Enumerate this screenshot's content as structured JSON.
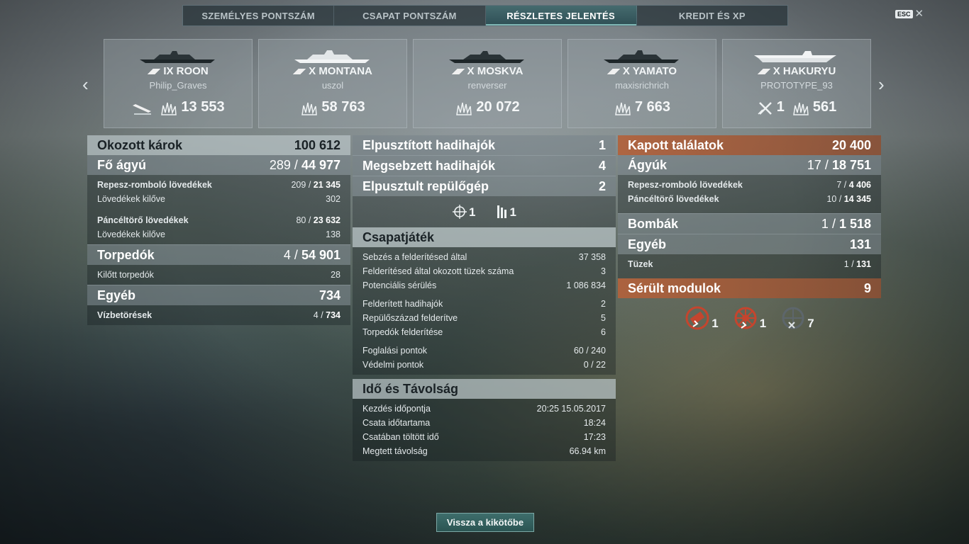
{
  "tabs": [
    "SZEMÉLYES PONTSZÁM",
    "CSAPAT PONTSZÁM",
    "RÉSZLETES JELENTÉS",
    "KREDIT ÉS XP"
  ],
  "esc_label": "ESC",
  "ships": [
    {
      "name": "IX ROON",
      "player": "Philip_Graves",
      "stat1_icon": "sunk-ship-icon",
      "stat1": "",
      "damage": "13 553"
    },
    {
      "name": "X MONTANA",
      "player": "uszol",
      "stat1_icon": "",
      "stat1": "",
      "damage": "58 763"
    },
    {
      "name": "X MOSKVA",
      "player": "renverser",
      "stat1_icon": "",
      "stat1": "",
      "damage": "20 072"
    },
    {
      "name": "X YAMATO",
      "player": "maxisrichrich",
      "stat1_icon": "",
      "stat1": "",
      "damage": "7 663"
    },
    {
      "name": "X HAKURYU",
      "player": "PROTOTYPE_93",
      "stat1_icon": "plane-shot-icon",
      "stat1": "1",
      "damage": "561"
    }
  ],
  "left": {
    "damage_label": "Okozott károk",
    "damage_value": "100 612",
    "main_label": "Fő ágyú",
    "main_hits": "289",
    "main_dmg": "44 977",
    "he_label": "Repesz-romboló lövedékek",
    "he_hits": "209",
    "he_dmg": "21 345",
    "he_fired_label": "Lövedékek kilőve",
    "he_fired": "302",
    "ap_label": "Páncéltörő lövedékek",
    "ap_hits": "80",
    "ap_dmg": "23 632",
    "ap_fired_label": "Lövedékek kilőve",
    "ap_fired": "138",
    "torp_label": "Torpedók",
    "torp_hits": "4",
    "torp_dmg": "54 901",
    "torp_fired_label": "Kilőtt torpedók",
    "torp_fired": "28",
    "other_label": "Egyéb",
    "other_value": "734",
    "flood_label": "Vízbetörések",
    "flood_hits": "4",
    "flood_dmg": "734"
  },
  "middle": {
    "destroyed_label": "Elpusztított hadihajók",
    "destroyed": "1",
    "damaged_label": "Megsebzett hadihajók",
    "damaged": "4",
    "planes_label": "Elpusztult repülőgép",
    "planes": "2",
    "icon_a": "1",
    "icon_b": "1",
    "team_label": "Csapatjáték",
    "team_rows": [
      {
        "label": "Sebzés a felderítésed által",
        "value": "37 358"
      },
      {
        "label": "Felderítésed által okozott tüzek száma",
        "value": "3"
      },
      {
        "label": "Potenciális sérülés",
        "value": "1 086 834"
      },
      {
        "label": "Felderített hadihajók",
        "value": "2"
      },
      {
        "label": "Repülőszázad felderítve",
        "value": "5"
      },
      {
        "label": "Torpedók felderítése",
        "value": "6"
      },
      {
        "label": "Foglalási pontok",
        "value": "60 / 240"
      },
      {
        "label": "Védelmi pontok",
        "value": "0 / 22"
      }
    ],
    "time_label": "Idő és Távolság",
    "time_rows": [
      {
        "label": "Kezdés időpontja",
        "value": "20:25  15.05.2017"
      },
      {
        "label": "Csata időtartama",
        "value": "18:24"
      },
      {
        "label": "Csatában töltött idő",
        "value": "17:23"
      },
      {
        "label": "Megtett távolság",
        "value": "66.94 km"
      }
    ]
  },
  "right": {
    "received_label": "Kapott találatok",
    "received_value": "20 400",
    "guns_label": "Ágyúk",
    "guns_hits": "17",
    "guns_dmg": "18 751",
    "he_label": "Repesz-romboló lövedékek",
    "he_hits": "7",
    "he_dmg": "4 406",
    "ap_label": "Páncéltörő lövedékek",
    "ap_hits": "10",
    "ap_dmg": "14 345",
    "bombs_label": "Bombák",
    "bombs_hits": "1",
    "bombs_dmg": "1 518",
    "other_label": "Egyéb",
    "other_value": "131",
    "fires_label": "Tüzek",
    "fires_hits": "1",
    "fires_dmg": "131",
    "modules_label": "Sérült modulok",
    "modules_value": "9",
    "module_counts": [
      "1",
      "1",
      "7"
    ]
  },
  "back_button": "Vissza a kikötőbe"
}
